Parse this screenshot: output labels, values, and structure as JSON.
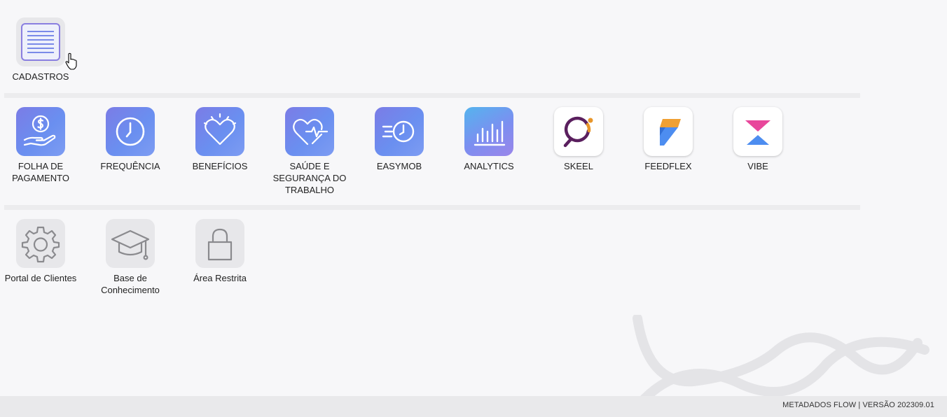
{
  "top_row": [
    {
      "label": "CADASTROS",
      "icon": "list-document-icon"
    }
  ],
  "apps_row": [
    {
      "label": "FOLHA DE\nPAGAMENTO",
      "icon": "hand-money-icon"
    },
    {
      "label": "FREQUÊNCIA",
      "icon": "clock-icon"
    },
    {
      "label": "BENEFÍCIOS",
      "icon": "heart-icon"
    },
    {
      "label": "SAÚDE E\nSEGURANÇA DO\nTRABALHO",
      "icon": "heart-pulse-icon"
    },
    {
      "label": "EASYMOB",
      "icon": "fast-clock-icon"
    },
    {
      "label": "ANALYTICS",
      "icon": "bar-chart-icon"
    },
    {
      "label": "SKEEL",
      "icon": "skeel-logo-icon"
    },
    {
      "label": "FEEDFLEX",
      "icon": "feedflex-logo-icon"
    },
    {
      "label": "VIBE",
      "icon": "vibe-logo-icon"
    }
  ],
  "support_row": [
    {
      "label": "Portal de Clientes",
      "icon": "gear-icon"
    },
    {
      "label": "Base de\nConhecimento",
      "icon": "graduation-cap-icon"
    },
    {
      "label": "Área Restrita",
      "icon": "lock-icon"
    }
  ],
  "footer": {
    "text": "METADADOS FLOW | VERSÃO 202309.01"
  },
  "colors": {
    "background": "#f7f7f9",
    "gradient_start": "#7b7ce6",
    "gradient_end": "#7d9cf2",
    "footer_bg": "#e9e9eb"
  }
}
